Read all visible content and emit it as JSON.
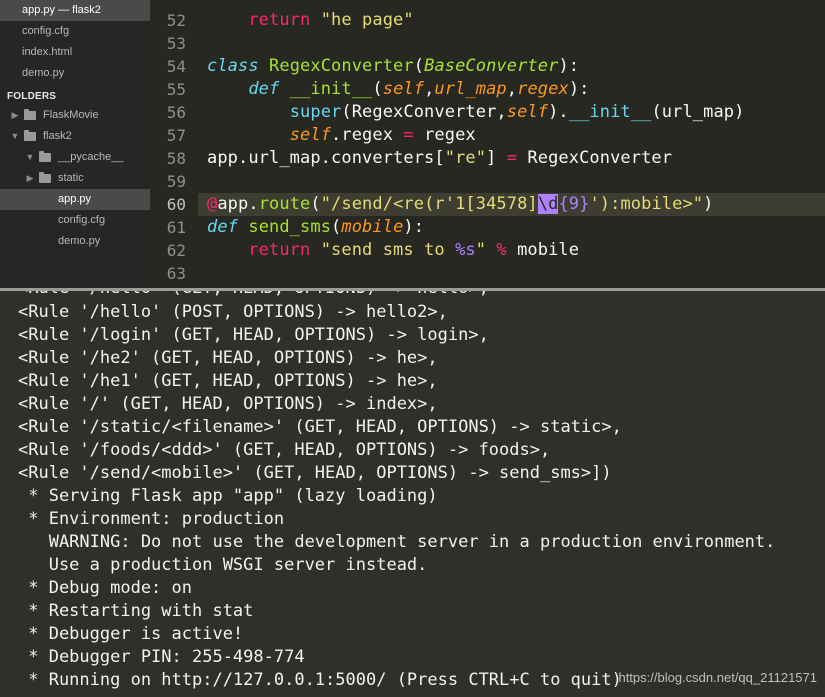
{
  "sidebar": {
    "open_files": [
      {
        "label": "app.py — flask2",
        "active": true
      },
      {
        "label": "config.cfg",
        "active": false
      },
      {
        "label": "index.html",
        "active": false
      },
      {
        "label": "demo.py",
        "active": false
      }
    ],
    "folders_header": "FOLDERS",
    "tree": [
      {
        "label": "FlaskMovie"
      },
      {
        "label": "flask2"
      },
      {
        "label": "__pycache__"
      },
      {
        "label": "static"
      },
      {
        "label": "app.py"
      },
      {
        "label": "config.cfg"
      },
      {
        "label": "demo.py"
      }
    ]
  },
  "editor": {
    "line_numbers": [
      "52",
      "53",
      "54",
      "55",
      "56",
      "57",
      "58",
      "59",
      "60",
      "61",
      "62",
      "63"
    ],
    "line52": {
      "kw": "return",
      "str": "\"he page\""
    },
    "line54": {
      "kw": "class",
      "name": "RegexConverter",
      "open": "(",
      "base": "BaseConverter",
      "close": "):"
    },
    "line55": {
      "kw": "def",
      "name": "__init__",
      "open": "(",
      "p1": "self",
      "c1": ",",
      "p2": "url_map",
      "c2": ",",
      "p3": "regex",
      "close": "):"
    },
    "line56": {
      "super": "super",
      "a": "(RegexConverter,",
      "self": "self",
      "b": ").",
      "init": "__init__",
      "c": "(url_map)"
    },
    "line57": {
      "self": "self",
      "a": ".regex ",
      "eq": "=",
      "b": " regex"
    },
    "line58": {
      "a": "app.url_map.converters[",
      "str": "\"re\"",
      "b": "] ",
      "eq": "=",
      "c": " RegexConverter"
    },
    "line60": {
      "at": "@",
      "a": "app.",
      "route": "route",
      "b": "(",
      "s1": "\"/send/<re(r'1[34578]",
      "sel": "\\d",
      "rx": "{9}",
      "s2": "'):mobile>\"",
      "c": ")"
    },
    "line61": {
      "kw": "def",
      "name": "send_sms",
      "open": "(",
      "p": "mobile",
      "close": "):"
    },
    "line62": {
      "kw": "return",
      "s1": "\"send sms to ",
      "ph": "%s",
      "s2": "\"",
      "op": " % ",
      "var": "mobile"
    }
  },
  "terminal": {
    "lines": [
      "<Rule '/hello' (GET, HEAD, OPTIONS) -> hello>,",
      "<Rule '/hello' (POST, OPTIONS) -> hello2>,",
      "<Rule '/login' (GET, HEAD, OPTIONS) -> login>,",
      "<Rule '/he2' (GET, HEAD, OPTIONS) -> he>,",
      "<Rule '/he1' (GET, HEAD, OPTIONS) -> he>,",
      "<Rule '/' (GET, HEAD, OPTIONS) -> index>,",
      "<Rule '/static/<filename>' (GET, HEAD, OPTIONS) -> static>,",
      "<Rule '/foods/<ddd>' (GET, HEAD, OPTIONS) -> foods>,",
      "<Rule '/send/<mobile>' (GET, HEAD, OPTIONS) -> send_sms>])",
      " * Serving Flask app \"app\" (lazy loading)",
      " * Environment: production",
      "   WARNING: Do not use the development server in a production environment.",
      "   Use a production WSGI server instead.",
      " * Debug mode: on",
      " * Restarting with stat",
      " * Debugger is active!",
      " * Debugger PIN: 255-498-774",
      " * Running on http://127.0.0.1:5000/ (Press CTRL+C to quit)"
    ]
  },
  "watermark": "https://blog.csdn.net/qq_21121571"
}
